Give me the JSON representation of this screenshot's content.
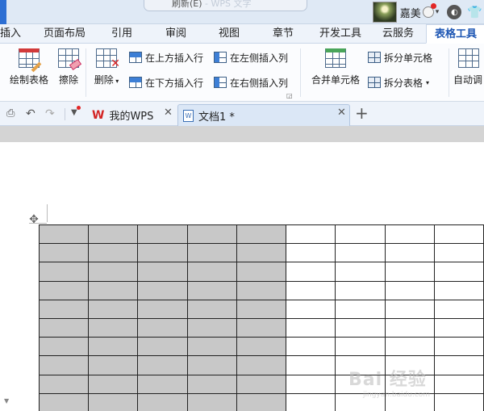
{
  "titlebar": {
    "pill_text": "刷新(E)",
    "pill_faded": "- WPS 文字",
    "user_name": "嘉美"
  },
  "ribbon_tabs": [
    {
      "label": "插入"
    },
    {
      "label": "页面布局"
    },
    {
      "label": "引用"
    },
    {
      "label": "审阅"
    },
    {
      "label": "视图"
    },
    {
      "label": "章节"
    },
    {
      "label": "开发工具"
    },
    {
      "label": "云服务"
    },
    {
      "label": "表格工具",
      "active": true
    }
  ],
  "ribbon": {
    "draw_table": "绘制表格",
    "erase": "擦除",
    "delete": "删除",
    "insert_above": "在上方插入行",
    "insert_below": "在下方插入行",
    "insert_left": "在左侧插入列",
    "insert_right": "在右侧插入列",
    "merge_cells": "合并单元格",
    "split_cells": "拆分单元格",
    "split_table": "拆分表格",
    "auto_adjust": "自动调"
  },
  "docbar": {
    "tabs": [
      {
        "label": "我的WPS"
      },
      {
        "label": "文档1 *",
        "active": true
      }
    ]
  },
  "table": {
    "rows": 10,
    "cols": 9,
    "shaded_cols": 5
  },
  "watermark": {
    "main": "Bai 经验",
    "sub": "jingyan.baidu.com"
  },
  "colors": {
    "accent_blue": "#1d56b3",
    "selection_gray": "#c8c8c8",
    "wps_red": "#d32424"
  }
}
